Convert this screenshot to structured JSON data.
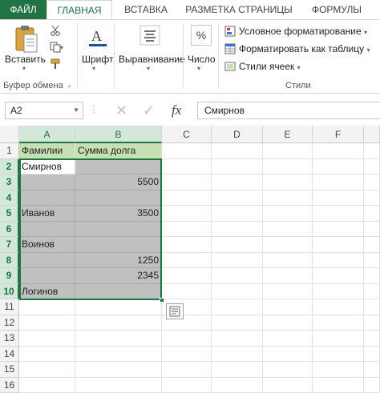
{
  "tabs": [
    "ФАЙЛ",
    "ГЛАВНАЯ",
    "ВСТАВКА",
    "РАЗМЕТКА СТРАНИЦЫ",
    "ФОРМУЛЫ"
  ],
  "ribbon": {
    "paste_label": "Вставить",
    "clipboard_group": "Буфер обмена",
    "font_label": "Шрифт",
    "align_label": "Выравнивание",
    "number_label": "Число",
    "cond_format": "Условное форматирование",
    "format_table": "Форматировать как таблицу",
    "cell_styles": "Стили ячеек",
    "styles_group": "Стили",
    "number_icon": "%"
  },
  "formula_bar": {
    "name_box": "A2",
    "formula": "Смирнов",
    "fx": "fx"
  },
  "grid": {
    "columns": [
      "A",
      "B",
      "C",
      "D",
      "E",
      "F"
    ],
    "rows": [
      "1",
      "2",
      "3",
      "4",
      "5",
      "6",
      "7",
      "8",
      "9",
      "10",
      "11",
      "12",
      "13",
      "14",
      "15",
      "16"
    ],
    "header_row": {
      "a": "Фамилии",
      "b": "Сумма долга"
    },
    "data": [
      {
        "a": "Смирнов",
        "b": ""
      },
      {
        "a": "",
        "b": "5500"
      },
      {
        "a": "",
        "b": ""
      },
      {
        "a": "Иванов",
        "b": "3500"
      },
      {
        "a": "",
        "b": ""
      },
      {
        "a": "Воинов",
        "b": ""
      },
      {
        "a": "",
        "b": "1250"
      },
      {
        "a": "",
        "b": "2345"
      },
      {
        "a": "Логинов",
        "b": ""
      }
    ]
  },
  "colors": {
    "accent": "#217346",
    "header_fill": "#c6e0b4",
    "selection_fill": "#c0c0c0"
  }
}
